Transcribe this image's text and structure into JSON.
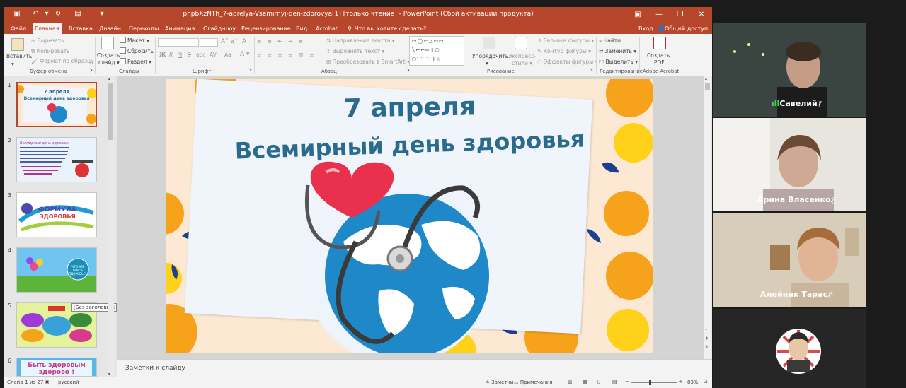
{
  "window": {
    "title": "phpbXzNTh_7-aprelya-Vsemirnyj-den-zdorovya[1] [только чтение] - PowerPoint (Сбой активации продукта)",
    "sign_in": "Вход",
    "share": "Общий доступ"
  },
  "tabs": [
    "Файл",
    "Главная",
    "Вставка",
    "Дизайн",
    "Переходы",
    "Анимация",
    "Слайд-шоу",
    "Рецензирование",
    "Вид",
    "Acrobat"
  ],
  "tell_me": "Что вы хотите сделать?",
  "ribbon": {
    "clipboard": {
      "paste": "Вставить",
      "cut": "Вырезать",
      "copy": "Копировать",
      "format_painter": "Формат по образцу",
      "group": "Буфер обмена"
    },
    "slides": {
      "new_slide": "Создать",
      "new_slide_2": "слайд",
      "layout": "Макет",
      "reset": "Сбросить",
      "section": "Раздел",
      "group": "Слайды"
    },
    "font": {
      "group": "Шрифт",
      "bold": "Ж",
      "italic": "К",
      "underline": "Ч",
      "strike": "S",
      "shadow": "abc",
      "spacing": "AV",
      "case": "Aa",
      "grow": "A",
      "shrink": "A",
      "color": "A",
      "clear": "A"
    },
    "paragraph": {
      "text_direction": "Направление текста",
      "align_text": "Выровнять текст",
      "smartart": "Преобразовать в SmartArt",
      "group": "Абзац"
    },
    "drawing": {
      "arrange": "Упорядочить",
      "quick_styles": "Экспресс-",
      "quick_styles_2": "стили",
      "fill": "Заливка фигуры",
      "outline": "Контур фигуры",
      "effects": "Эффекты фигуры",
      "group": "Рисование"
    },
    "editing": {
      "find": "Найти",
      "replace": "Заменить",
      "select": "Выделить",
      "group": "Редактирование"
    },
    "acrobat": {
      "create_pdf": "Создать",
      "create_pdf_2": "PDF",
      "group": "Adobe Acrobat"
    }
  },
  "thumbnails": [
    {
      "number": "1",
      "text": "7 апреля\nВсемирный день здоровья"
    },
    {
      "number": "2",
      "text": "Всемирный день здоровья – отмечается ежегодно 7 апреля начиная с 1950 года. В этот день в 1948 году вступил в силу устав Всемирной организации здравоохранения (ВОЗ) В праздновании принимают участие 190 государств мира."
    },
    {
      "number": "3",
      "text": "ФОРМУЛА ЗДОРОВЬЯ"
    },
    {
      "number": "4",
      "text": "ЧТО ЖЕ ТАКОЕ ЗДОРОВЬЕ?"
    },
    {
      "number": "5",
      "text": ""
    },
    {
      "number": "6",
      "text": "Быть здоровым здорово !"
    }
  ],
  "tooltip": "[Без заголовка]",
  "slide": {
    "line1": "7 апреля",
    "line2": "Всемирный день здоровья"
  },
  "notes": "Заметки к слайду",
  "status": {
    "slide_counter": "Слайд 1 из 27",
    "language": "русский",
    "notes": "Заметки",
    "comments": "Примечания",
    "zoom": "83%"
  },
  "participants": [
    {
      "name": "Савелий"
    },
    {
      "name": "Арина Власенко"
    },
    {
      "name": "Алейник Тарас"
    },
    {
      "name": ""
    }
  ],
  "colors": {
    "accent": "#b7472a",
    "slide_title": "#2a6a8c",
    "heart": "#e9304c",
    "globe": "#1e88c8",
    "orange": "#f7a21b",
    "yellow": "#ffd11a",
    "navy": "#1c3f8f"
  }
}
